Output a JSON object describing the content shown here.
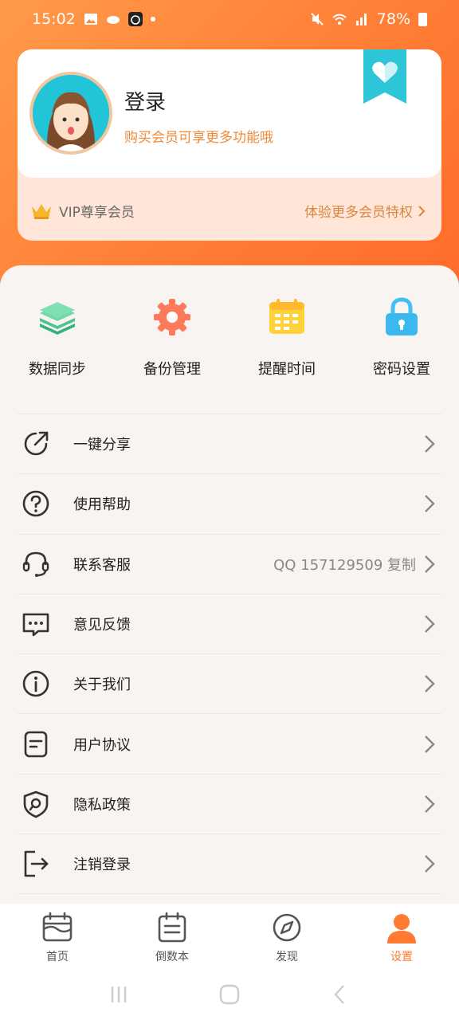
{
  "status": {
    "time": "15:02",
    "battery": "78%"
  },
  "profile": {
    "title": "登录",
    "subtitle": "购买会员可享更多功能哦",
    "vip_label": "VIP尊享会员",
    "vip_link": "体验更多会员特权"
  },
  "quick_actions": [
    {
      "label": "数据同步",
      "icon": "layers-icon"
    },
    {
      "label": "备份管理",
      "icon": "gear-icon"
    },
    {
      "label": "提醒时间",
      "icon": "calendar-icon"
    },
    {
      "label": "密码设置",
      "icon": "lock-icon"
    }
  ],
  "menu": [
    {
      "label": "一键分享",
      "icon": "share-icon",
      "extra": ""
    },
    {
      "label": "使用帮助",
      "icon": "help-icon",
      "extra": ""
    },
    {
      "label": "联系客服",
      "icon": "headset-icon",
      "extra": "QQ 157129509 复制"
    },
    {
      "label": "意见反馈",
      "icon": "feedback-icon",
      "extra": ""
    },
    {
      "label": "关于我们",
      "icon": "info-icon",
      "extra": ""
    },
    {
      "label": "用户协议",
      "icon": "document-icon",
      "extra": ""
    },
    {
      "label": "隐私政策",
      "icon": "privacy-shield-icon",
      "extra": ""
    },
    {
      "label": "注销登录",
      "icon": "logout-icon",
      "extra": ""
    }
  ],
  "tabs": [
    {
      "label": "首页",
      "icon": "home-calendar-icon"
    },
    {
      "label": "倒数本",
      "icon": "countdown-book-icon"
    },
    {
      "label": "发现",
      "icon": "compass-icon"
    },
    {
      "label": "设置",
      "icon": "person-icon"
    }
  ],
  "colors": {
    "accent": "#ff7a32",
    "vip_text": "#d9863f"
  }
}
